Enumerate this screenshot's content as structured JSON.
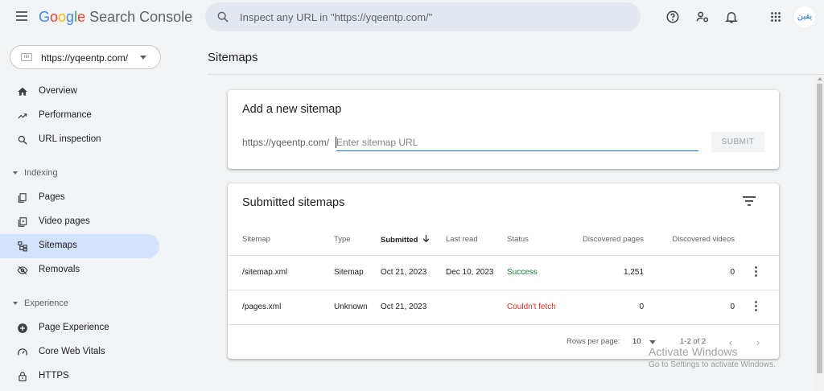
{
  "header": {
    "logo_letters": [
      "G",
      "o",
      "o",
      "g",
      "l",
      "e"
    ],
    "product": "Search Console",
    "search_placeholder": "Inspect any URL in \"https://yqeentp.com/\"",
    "avatar_text": "يقين"
  },
  "property": {
    "url": "https://yqeentp.com/",
    "favicon_text": "ıılı"
  },
  "nav": {
    "overview": "Overview",
    "performance": "Performance",
    "url_inspection": "URL inspection",
    "indexing": "Indexing",
    "pages": "Pages",
    "video_pages": "Video pages",
    "sitemaps": "Sitemaps",
    "removals": "Removals",
    "experience": "Experience",
    "page_experience": "Page Experience",
    "core_web_vitals": "Core Web Vitals",
    "https": "HTTPS"
  },
  "page": {
    "title": "Sitemaps"
  },
  "add_sitemap": {
    "title": "Add a new sitemap",
    "prefix": "https://yqeentp.com/",
    "placeholder": "Enter sitemap URL",
    "submit": "SUBMIT"
  },
  "submitted": {
    "title": "Submitted sitemaps",
    "columns": {
      "sitemap": "Sitemap",
      "type": "Type",
      "submitted": "Submitted",
      "last_read": "Last read",
      "status": "Status",
      "discovered_pages": "Discovered pages",
      "discovered_videos": "Discovered videos"
    },
    "rows": [
      {
        "sitemap": "/sitemap.xml",
        "type": "Sitemap",
        "submitted": "Oct 21, 2023",
        "last_read": "Dec 10, 2023",
        "status": "Success",
        "discovered_pages": "1,251",
        "discovered_videos": "0"
      },
      {
        "sitemap": "/pages.xml",
        "type": "Unknown",
        "submitted": "Oct 21, 2023",
        "last_read": "",
        "status": "Couldn't fetch",
        "discovered_pages": "0",
        "discovered_videos": "0"
      }
    ],
    "footer": {
      "rows_per_page_label": "Rows per page:",
      "rows_per_page": "10",
      "range": "1-2 of 2"
    }
  },
  "watermark": {
    "line1": "Activate Windows",
    "line2": "Go to Settings to activate Windows."
  },
  "colors": {
    "accent": "#1a73e8",
    "success": "#188038",
    "error": "#d93025",
    "active_nav": "#d3e3fd"
  }
}
